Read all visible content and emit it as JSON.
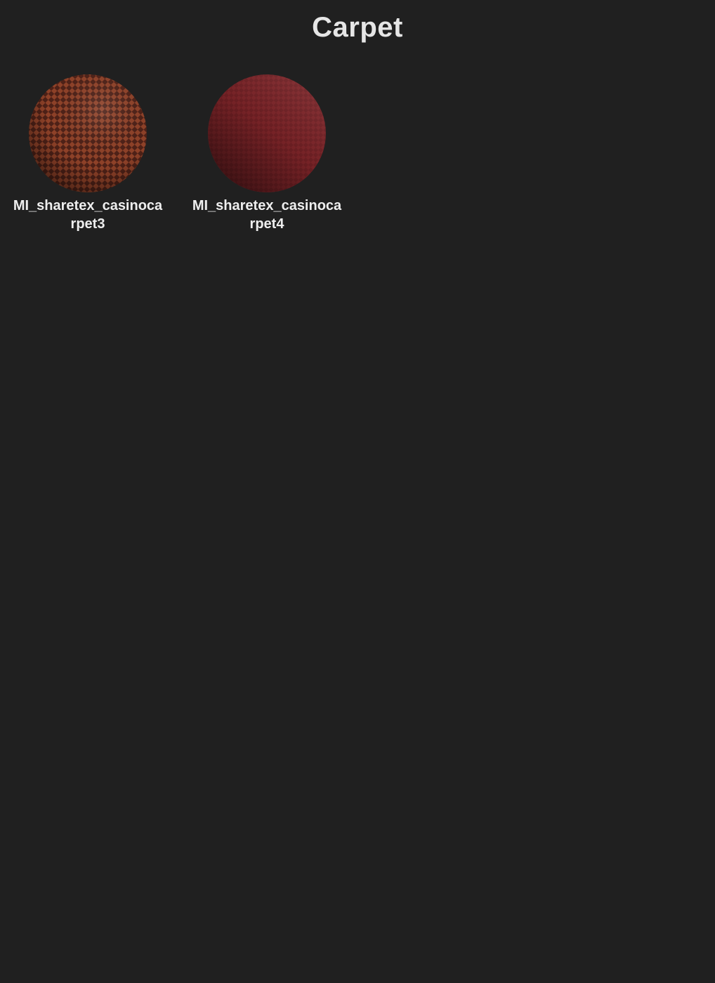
{
  "page": {
    "title": "Carpet",
    "background": "#202020"
  },
  "materials": [
    {
      "name": "MI_sharetex_casinocarpet3",
      "label_line1": "MI_sharetex_casinoca",
      "label_line2": "rpet3",
      "preview": "checker-sphere",
      "base_color": "#8a3f27",
      "pattern_color": "#4a1e14"
    },
    {
      "name": "MI_sharetex_casinocarpet4",
      "label_line1": "MI_sharetex_casinoca",
      "label_line2": "rpet4",
      "preview": "sphere",
      "base_color": "#7a2326",
      "pattern_color": "#5c1a1d"
    }
  ]
}
